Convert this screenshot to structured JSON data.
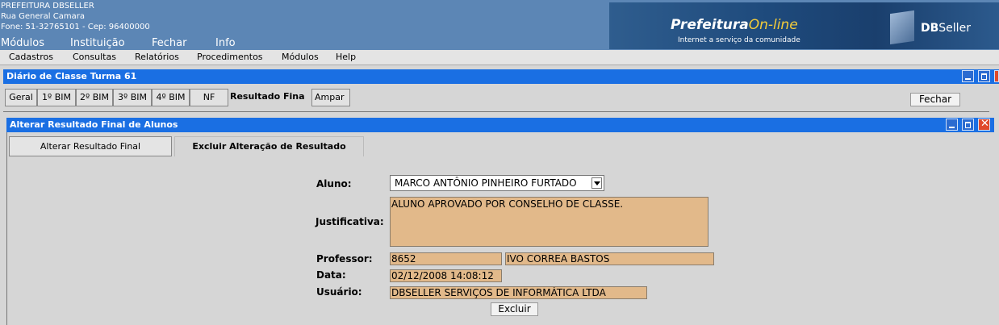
{
  "header": {
    "org_name": "PREFEITURA DBSELLER",
    "address": "Rua General Camara",
    "contact": "Fone: 51-32765101  -  Cep: 96400000",
    "top_menu": [
      "Módulos",
      "Instituição",
      "Fechar",
      "Info"
    ],
    "banner_prefeitura": "Prefeitura",
    "banner_online": "On-line",
    "banner_tagline": "Internet a serviço da comunidade",
    "banner_db": "DB",
    "banner_seller": "Seller"
  },
  "menubar": [
    "Cadastros",
    "Consultas",
    "Relatórios",
    "Procedimentos",
    "Módulos",
    "Help"
  ],
  "window": {
    "title": "Diário de Classe Turma 61",
    "tabs": [
      "Geral",
      "1º BIM",
      "2º BIM",
      "3º BIM",
      "4º BIM",
      "NF",
      "Resultado Fina",
      "Ampar"
    ],
    "active_tab": "Resultado Fina",
    "close_button": "Fechar"
  },
  "inner_window": {
    "title": "Alterar Resultado Final de Alunos",
    "tabs": [
      "Alterar Resultado Final",
      "Excluir Alteração de Resultado"
    ],
    "active_tab": "Excluir Alteração de Resultado"
  },
  "form": {
    "aluno_label": "Aluno:",
    "aluno_value": "MARCO ANTÔNIO PINHEIRO FURTADO",
    "justificativa_label": "Justificativa:",
    "justificativa_value": "ALUNO APROVADO POR CONSELHO DE CLASSE.",
    "professor_label": "Professor:",
    "professor_code": "8652",
    "professor_name": "IVO CORREA BASTOS",
    "data_label": "Data:",
    "data_value": "02/12/2008 14:08:12",
    "usuario_label": "Usuário:",
    "usuario_value": "DBSELLER SERVIÇOS DE INFORMÁTICA LTDA",
    "excluir_button": "Excluir"
  },
  "colors": {
    "header_bg": "#5c86b5",
    "titlebar": "#1a6fe3",
    "field_bg": "#e2b98a"
  }
}
